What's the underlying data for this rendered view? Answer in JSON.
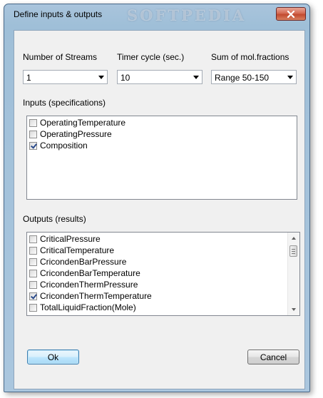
{
  "window": {
    "title": "Define inputs & outputs",
    "watermark": "SOFTPEDIA",
    "close_icon": "close-icon"
  },
  "settings": {
    "streams": {
      "label": "Number of Streams",
      "value": "1"
    },
    "timer": {
      "label": "Timer cycle (sec.)",
      "value": "10"
    },
    "molfrac": {
      "label": "Sum of mol.fractions",
      "value": "Range 50-150"
    }
  },
  "inputs": {
    "label": "Inputs (specifications)",
    "items": [
      {
        "label": "OperatingTemperature",
        "checked": false
      },
      {
        "label": "OperatingPressure",
        "checked": false
      },
      {
        "label": "Composition",
        "checked": true
      }
    ]
  },
  "outputs": {
    "label": "Outputs (results)",
    "items": [
      {
        "label": "CriticalPressure",
        "checked": false
      },
      {
        "label": "CriticalTemperature",
        "checked": false
      },
      {
        "label": "CricondenBarPressure",
        "checked": false
      },
      {
        "label": "CricondenBarTemperature",
        "checked": false
      },
      {
        "label": "CricondenThermPressure",
        "checked": false
      },
      {
        "label": "CricondenThermTemperature",
        "checked": true
      },
      {
        "label": "TotalLiquidFraction(Mole)",
        "checked": false
      }
    ]
  },
  "buttons": {
    "ok": "Ok",
    "cancel": "Cancel"
  }
}
